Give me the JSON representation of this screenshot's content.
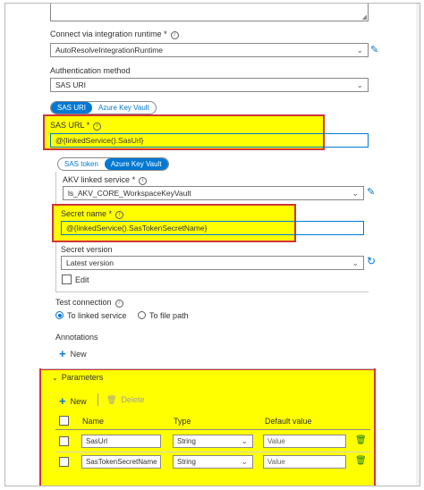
{
  "connect_via": {
    "label": "Connect via integration runtime",
    "required": "*",
    "value": "AutoResolveIntegrationRuntime"
  },
  "auth": {
    "label": "Authentication method",
    "value": "SAS URI"
  },
  "sas_toggle": {
    "option_a": "SAS URI",
    "option_b": "Azure Key Vault",
    "selected": "SAS URI"
  },
  "sas_url": {
    "label": "SAS URL",
    "required": "*",
    "value": "@{linkedService().SasUrl}"
  },
  "token_toggle": {
    "option_a": "SAS token",
    "option_b": "Azure Key Vault",
    "selected": "Azure Key Vault"
  },
  "akv": {
    "label": "AKV linked service",
    "required": "*",
    "value": "ls_AKV_CORE_WorkspaceKeyVault"
  },
  "secret_name": {
    "label": "Secret name",
    "required": "*",
    "value": "@{linkedService().SasTokenSecretName}"
  },
  "secret_version": {
    "label": "Secret version",
    "value": "Latest version",
    "edit_label": "Edit"
  },
  "test_connection": {
    "label": "Test connection",
    "option_a": "To linked service",
    "option_b": "To file path",
    "selected": "To linked service"
  },
  "annotations": {
    "label": "Annotations",
    "new_label": "New"
  },
  "parameters": {
    "label": "Parameters",
    "new_label": "New",
    "delete_label": "Delete",
    "columns": [
      "Name",
      "Type",
      "Default value"
    ],
    "rows": [
      {
        "name": "SasUrl",
        "type": "String",
        "default_placeholder": "Value"
      },
      {
        "name": "SasTokenSecretName",
        "type": "String",
        "default_placeholder": "Value"
      }
    ]
  },
  "colors": {
    "accent": "#0078d4",
    "highlight": "#ffff00",
    "highlight_border": "#d13438",
    "delete_icon": "#107c10"
  }
}
